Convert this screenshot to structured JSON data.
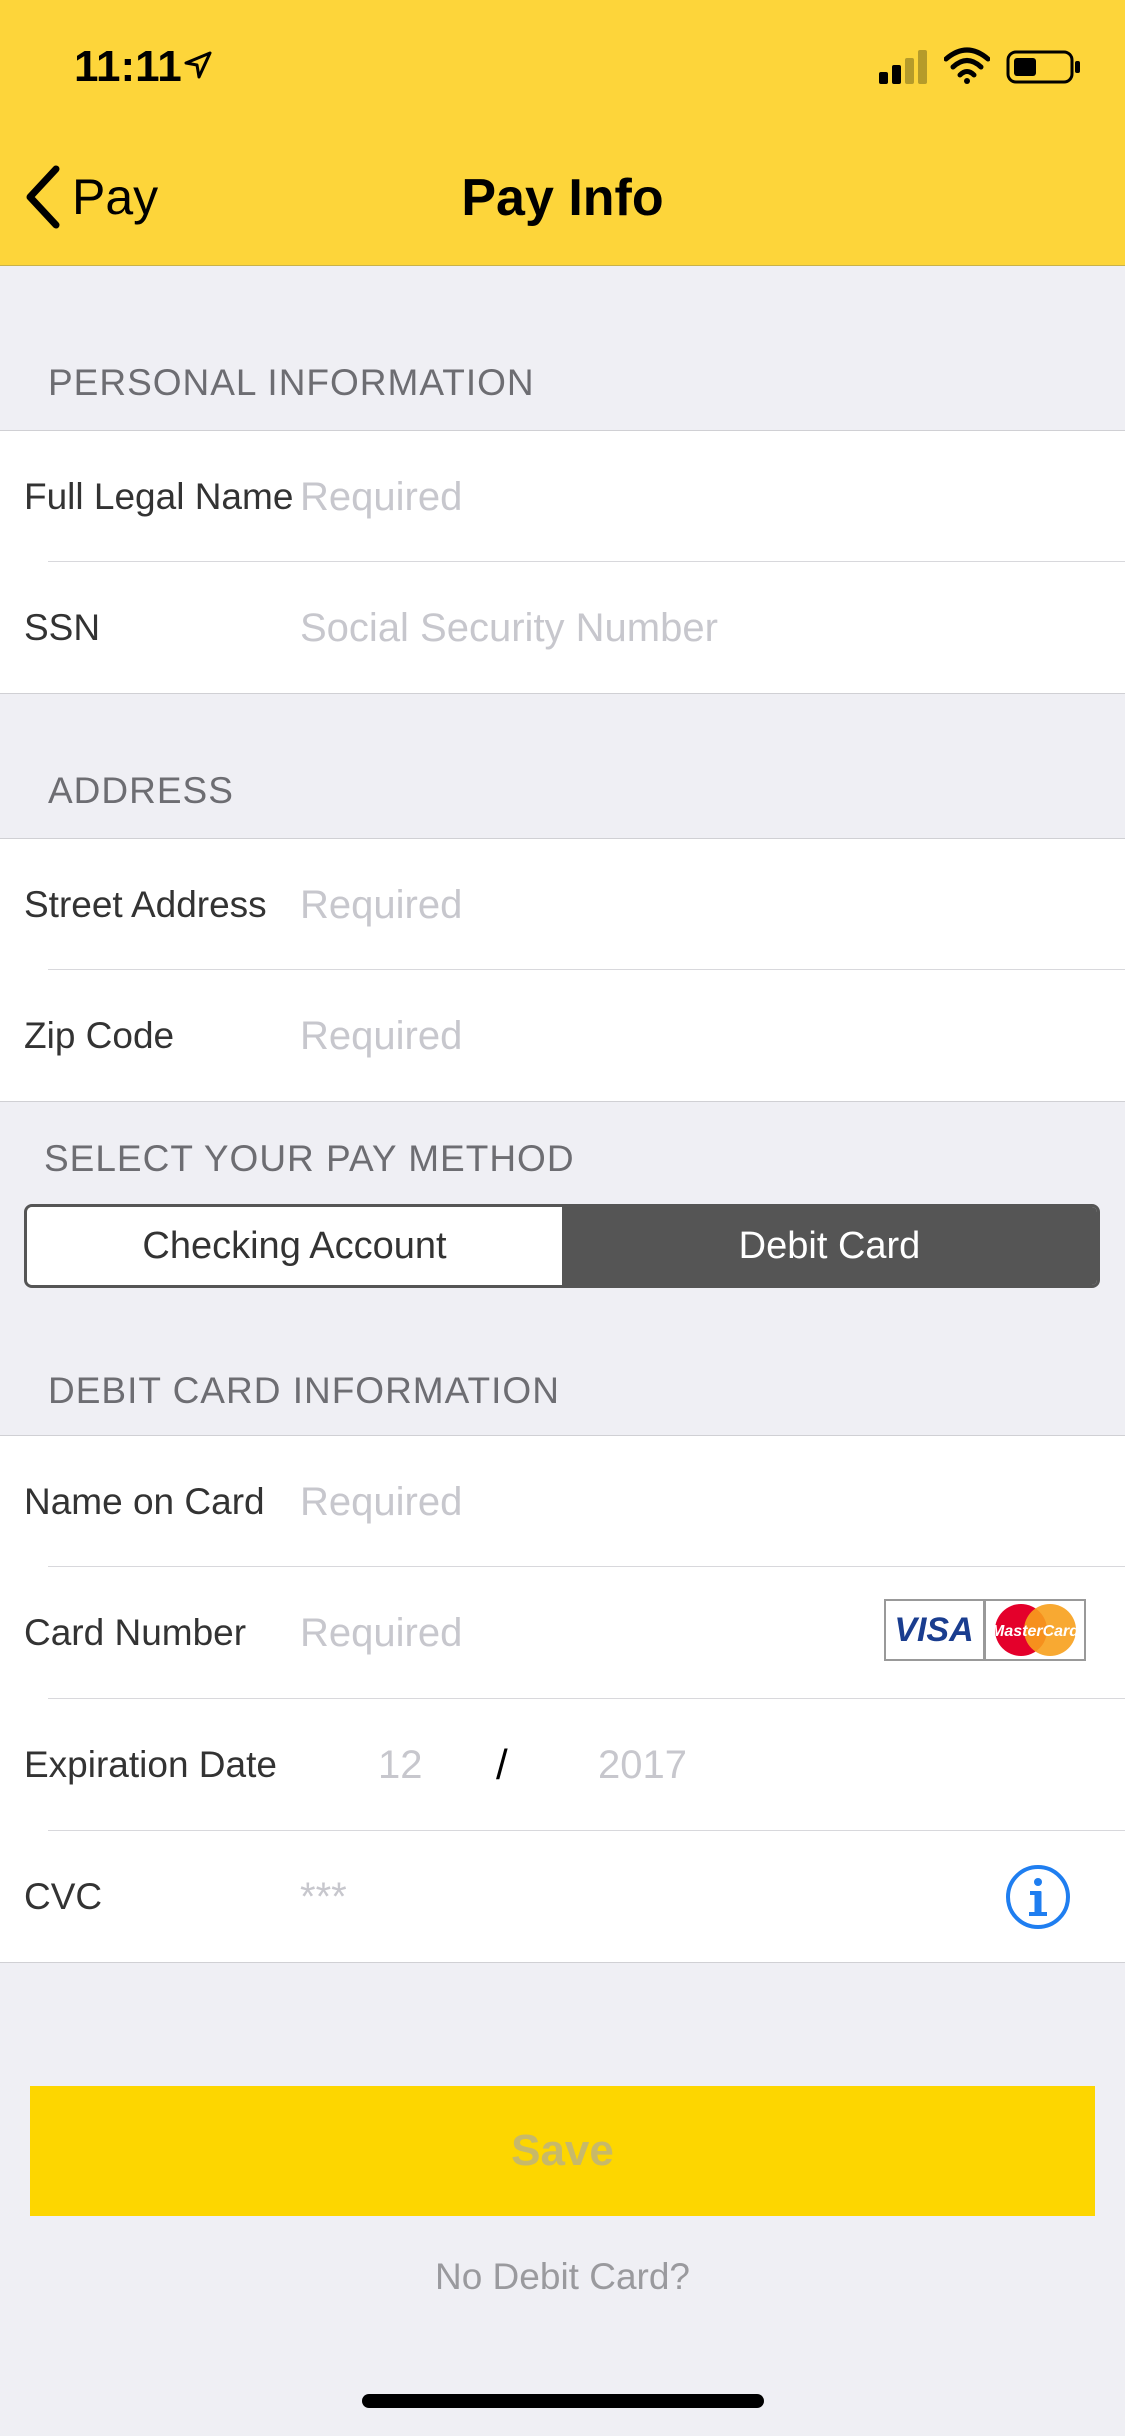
{
  "status_bar": {
    "time": "11:11"
  },
  "nav": {
    "back_label": "Pay",
    "title": "Pay Info"
  },
  "personal": {
    "header": "PERSONAL INFORMATION",
    "name_label": "Full Legal Name",
    "name_placeholder": "Required",
    "ssn_label": "SSN",
    "ssn_placeholder": "Social Security Number"
  },
  "address": {
    "header": "ADDRESS",
    "street_label": "Street Address",
    "street_placeholder": "Required",
    "zip_label": "Zip Code",
    "zip_placeholder": "Required"
  },
  "pay_method": {
    "header": "SELECT YOUR PAY METHOD",
    "options": [
      "Checking Account",
      "Debit Card"
    ],
    "selected": "Debit Card"
  },
  "debit": {
    "header": "DEBIT CARD INFORMATION",
    "name_label": "Name on Card",
    "name_placeholder": "Required",
    "number_label": "Card Number",
    "number_placeholder": "Required",
    "card_brands": [
      "VISA",
      "MasterCard"
    ],
    "exp_label": "Expiration Date",
    "exp_month": "12",
    "exp_sep": "/",
    "exp_year": "2017",
    "cvc_label": "CVC",
    "cvc_placeholder": "***"
  },
  "actions": {
    "save_label": "Save",
    "no_debit_label": "No Debit Card?"
  },
  "colors": {
    "header_bg": "#fdd53a",
    "save_bg": "#fdd600",
    "info_blue": "#1f7ef0",
    "segment_active": "#555555"
  }
}
